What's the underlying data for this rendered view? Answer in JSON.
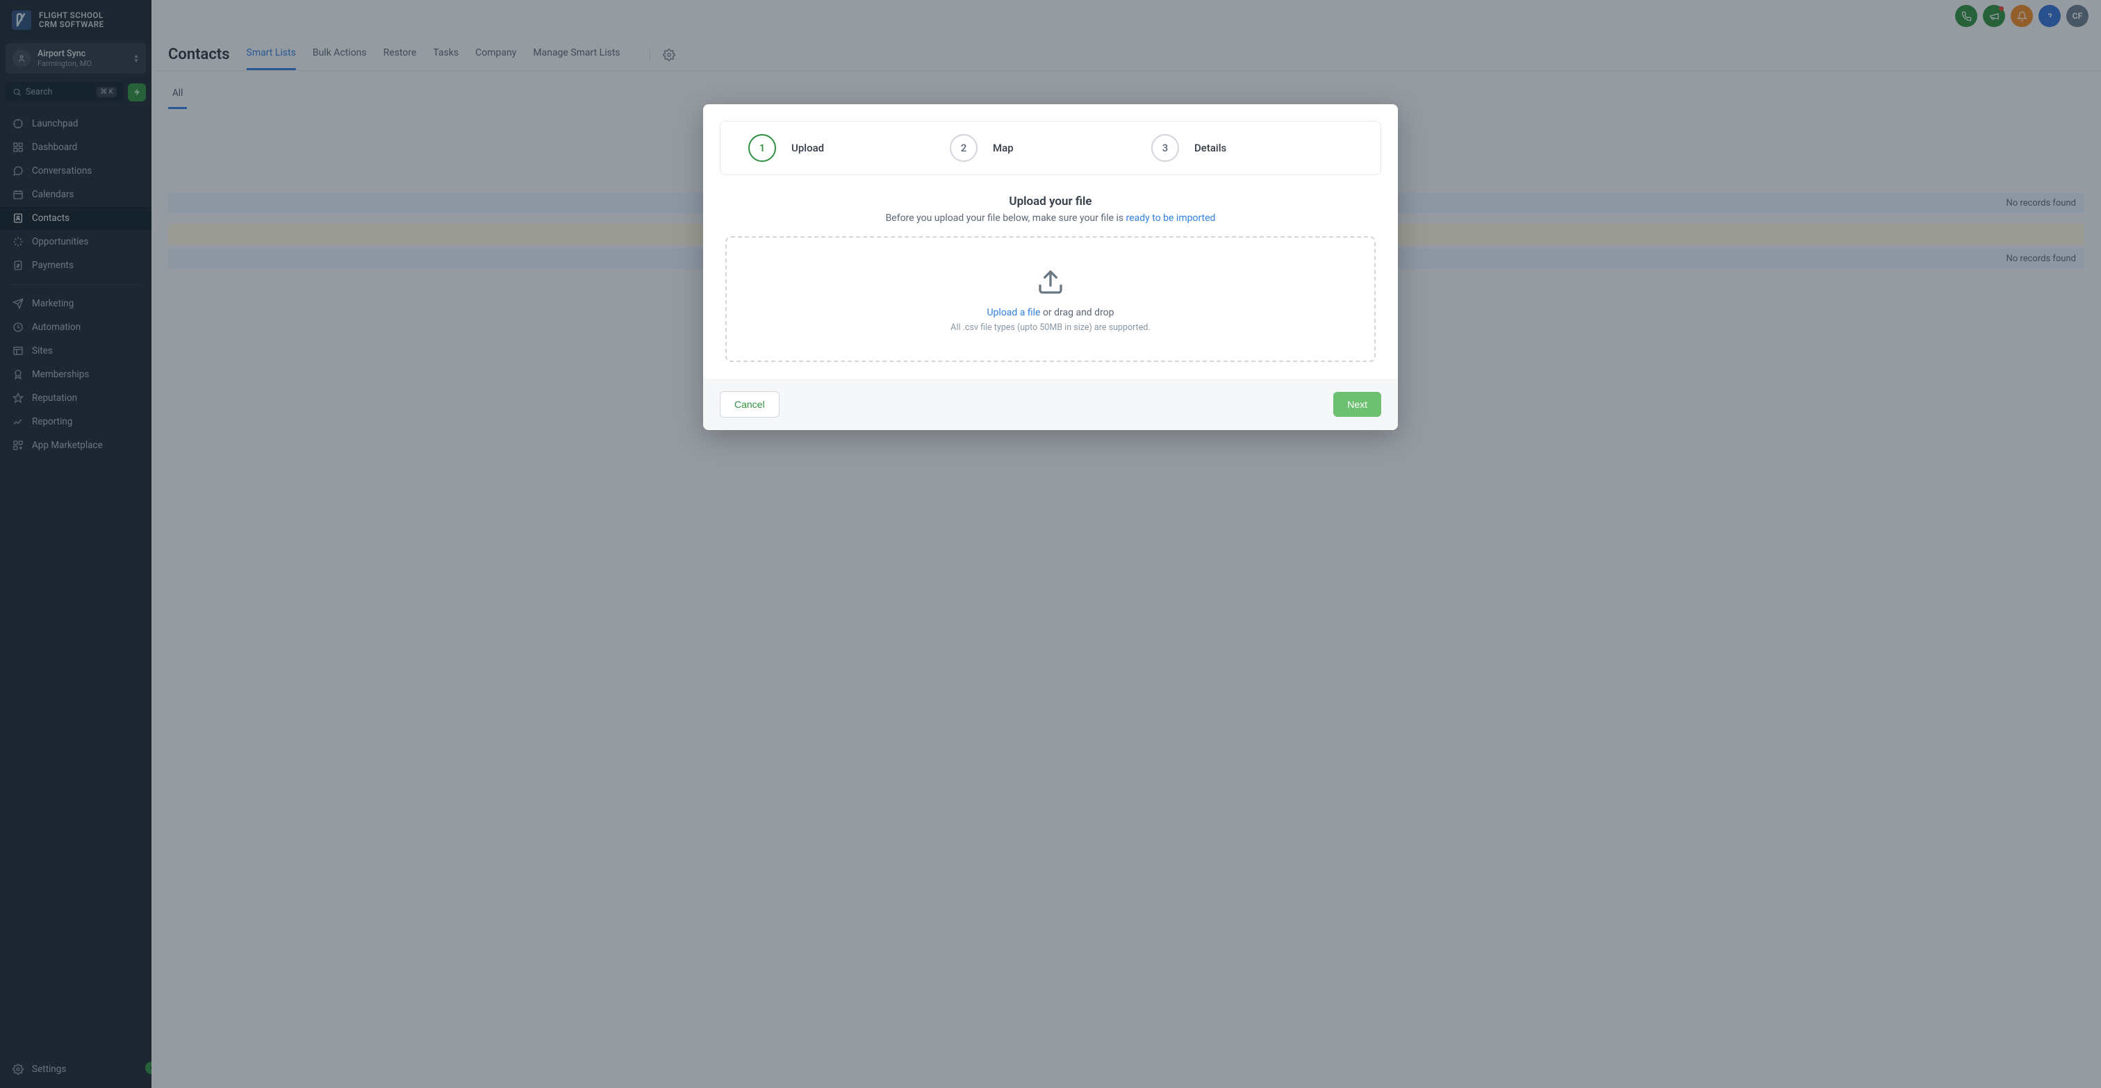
{
  "brand": {
    "line1": "FLIGHT SCHOOL",
    "line2": "CRM SOFTWARE"
  },
  "org": {
    "name": "Airport Sync",
    "location": "Farmington, MO"
  },
  "search": {
    "placeholder": "Search",
    "shortcut": "⌘ K"
  },
  "nav": {
    "group1": [
      {
        "label": "Launchpad"
      },
      {
        "label": "Dashboard"
      },
      {
        "label": "Conversations"
      },
      {
        "label": "Calendars"
      },
      {
        "label": "Contacts",
        "active": true
      },
      {
        "label": "Opportunities"
      },
      {
        "label": "Payments"
      }
    ],
    "group2": [
      {
        "label": "Marketing"
      },
      {
        "label": "Automation"
      },
      {
        "label": "Sites"
      },
      {
        "label": "Memberships"
      },
      {
        "label": "Reputation"
      },
      {
        "label": "Reporting"
      },
      {
        "label": "App Marketplace"
      }
    ],
    "settings": "Settings"
  },
  "header": {
    "title": "Contacts",
    "tabs": [
      "Smart Lists",
      "Bulk Actions",
      "Restore",
      "Tasks",
      "Company",
      "Manage Smart Lists"
    ],
    "activeTab": 0,
    "subtab": "All"
  },
  "user": {
    "initials": "CF"
  },
  "bg": {
    "row1": "No records found",
    "row3": "No records found"
  },
  "modal": {
    "steps": [
      {
        "num": "1",
        "label": "Upload"
      },
      {
        "num": "2",
        "label": "Map"
      },
      {
        "num": "3",
        "label": "Details"
      }
    ],
    "title": "Upload your file",
    "subPrefix": "Before you upload your file below, make sure your file is ",
    "subLink": "ready to be imported",
    "dz": {
      "link": "Upload a file",
      "rest": " or drag and drop",
      "hint": "All .csv file types (upto 50MB in size) are supported."
    },
    "cancel": "Cancel",
    "next": "Next"
  }
}
